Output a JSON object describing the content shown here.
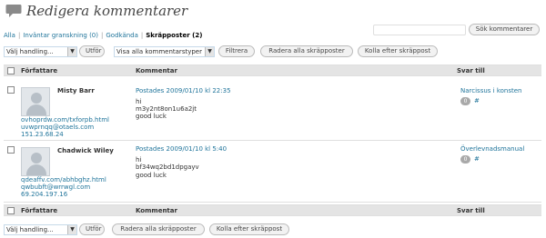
{
  "header": {
    "title": "Redigera kommentarer",
    "icon": "comments-icon"
  },
  "search": {
    "button": "Sök kommentarer"
  },
  "filters": {
    "all": "Alla",
    "pending": "Inväntar granskning (0)",
    "approved": "Godkända",
    "spam": "Skräpposter (2)"
  },
  "toolbar_top": {
    "bulk_select": "Välj handling...",
    "apply": "Utför",
    "type_select": "Visa alla kommentarstyper",
    "filter": "Filtrera",
    "delete_all": "Radera alla skräpposter",
    "check_spam": "Kolla efter skräppost"
  },
  "table": {
    "columns": {
      "author": "Författare",
      "comment": "Kommentar",
      "reply_to": "Svar till"
    },
    "rows": [
      {
        "author": "Misty Barr",
        "url": "ovhoprdw.com/txforpb.html",
        "email": "uvwprnqq@otaels.com",
        "ip": "151.23.68.24",
        "posted": "Postades 2009/01/10 kl 22:35",
        "lines": [
          "hi",
          "m3y2nt8on1u6a2jt",
          "good luck"
        ],
        "post": "Narcissus i konsten",
        "count": "0",
        "hash": "#"
      },
      {
        "author": "Chadwick Wiley",
        "url": "qdeaffv.com/abhbghz.html",
        "email": "qwbubft@wrrwgl.com",
        "ip": "69.204.197.16",
        "posted": "Postades 2009/01/10 kl 5:40",
        "lines": [
          "hi",
          "bf34wq2bd1dpgayv",
          "good luck"
        ],
        "post": "Överlevnadsmanual",
        "count": "0",
        "hash": "#"
      }
    ]
  },
  "toolbar_bottom": {
    "bulk_select": "Välj handling...",
    "apply": "Utför",
    "delete_all": "Radera alla skräpposter",
    "check_spam": "Kolla efter skräppost"
  }
}
